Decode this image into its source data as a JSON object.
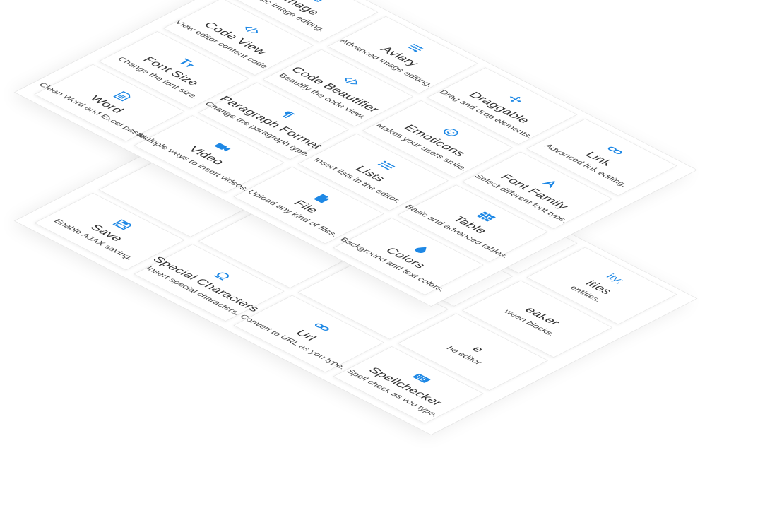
{
  "accent_color": "#1e88e5",
  "front_features": [
    {
      "title": "Image",
      "desc": "Basic image editing.",
      "icon": "image-icon"
    },
    {
      "title": "Aviary",
      "desc": "Advanced image editing.",
      "icon": "sliders-icon"
    },
    {
      "title": "Draggable",
      "desc": "Drag and drop elements.",
      "icon": "move-icon"
    },
    {
      "title": "Link",
      "desc": "Advanced link editing.",
      "icon": "link-icon"
    },
    {
      "title": "Code View",
      "desc": "View editor content code.",
      "icon": "code-icon"
    },
    {
      "title": "Code Beautifier",
      "desc": "Beautify the code view.",
      "icon": "code-icon"
    },
    {
      "title": "Emoticons",
      "desc": "Makes your users smile.",
      "icon": "smile-icon"
    },
    {
      "title": "Font Family",
      "desc": "Select different font type.",
      "icon": "font-icon"
    },
    {
      "title": "Font Size",
      "desc": "Change the font size.",
      "icon": "text-height-icon"
    },
    {
      "title": "Paragraph Format",
      "desc": "Change the paragraph type.",
      "icon": "paragraph-icon"
    },
    {
      "title": "Lists",
      "desc": "Insert lists in the editor.",
      "icon": "list-icon"
    },
    {
      "title": "Table",
      "desc": "Basic and advanced tables.",
      "icon": "table-icon"
    },
    {
      "title": "Word",
      "desc": "Clean Word and Excel paste.",
      "icon": "word-icon"
    },
    {
      "title": "Video",
      "desc": "Multiple ways to insert videos.",
      "icon": "video-icon"
    },
    {
      "title": "File",
      "desc": "Upload any kind of files.",
      "icon": "file-icon"
    },
    {
      "title": "Colors",
      "desc": "Background and text colors.",
      "icon": "tint-icon"
    }
  ],
  "back_features": [
    {
      "title": "",
      "desc": "",
      "icon": ""
    },
    {
      "title": "",
      "desc": "",
      "icon": ""
    },
    {
      "title": "",
      "desc": "",
      "icon": ""
    },
    {
      "title": "ities",
      "desc": "entities.",
      "icon": "entities-icon",
      "icon_text": "ity;"
    },
    {
      "title": "",
      "desc": "",
      "icon": ""
    },
    {
      "title": "",
      "desc": "",
      "icon": ""
    },
    {
      "title": "",
      "desc": "",
      "icon": ""
    },
    {
      "title": "eaker",
      "desc": "ween blocks.",
      "icon": ""
    },
    {
      "title": "",
      "desc": "",
      "icon": ""
    },
    {
      "title": "",
      "desc": "",
      "icon": ""
    },
    {
      "title": "",
      "desc": "",
      "icon": ""
    },
    {
      "title": "e",
      "desc": "he editor.",
      "icon": ""
    },
    {
      "title": "Save",
      "desc": "Enable AJAX saving.",
      "icon": "save-icon"
    },
    {
      "title": "Special Characters",
      "desc": "Insert special characters.",
      "icon": "omega-icon"
    },
    {
      "title": "Url",
      "desc": "Convert to URL as you type.",
      "icon": "link-icon"
    },
    {
      "title": "Spellchecker",
      "desc": "Spell check as you type.",
      "icon": "keyboard-icon"
    }
  ]
}
